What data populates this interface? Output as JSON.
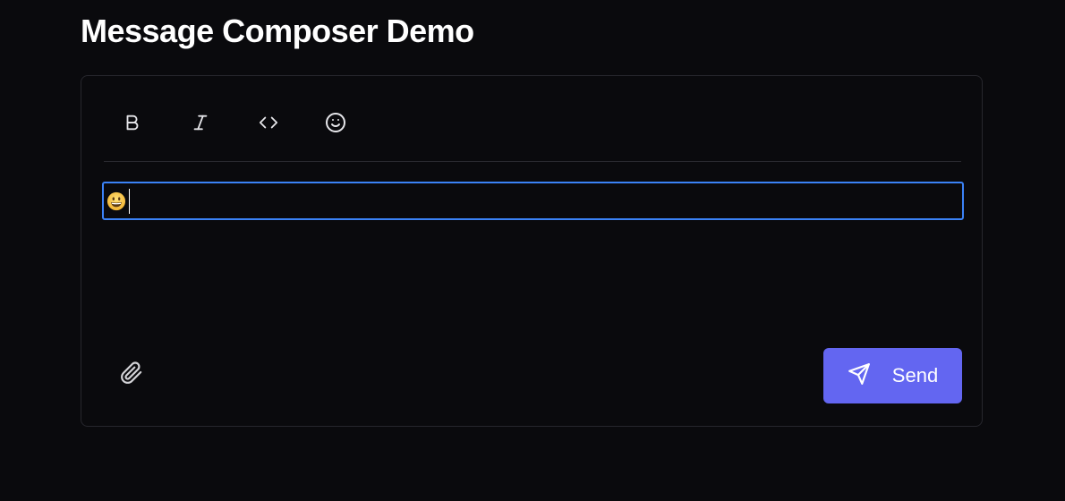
{
  "page": {
    "title": "Message Composer Demo"
  },
  "toolbar": {
    "items": [
      {
        "name": "bold",
        "icon": "bold-icon"
      },
      {
        "name": "italic",
        "icon": "italic-icon"
      },
      {
        "name": "code",
        "icon": "code-icon"
      },
      {
        "name": "emoji",
        "icon": "smiley-icon"
      }
    ]
  },
  "editor": {
    "content_emoji": "😀",
    "focused": true
  },
  "footer": {
    "attach_icon": "paperclip-icon",
    "send_label": "Send",
    "send_icon": "paper-plane-icon"
  },
  "colors": {
    "background": "#0a0a0d",
    "border": "#27272d",
    "focus_ring": "#3b82f6",
    "send_button": "#6366f1"
  }
}
